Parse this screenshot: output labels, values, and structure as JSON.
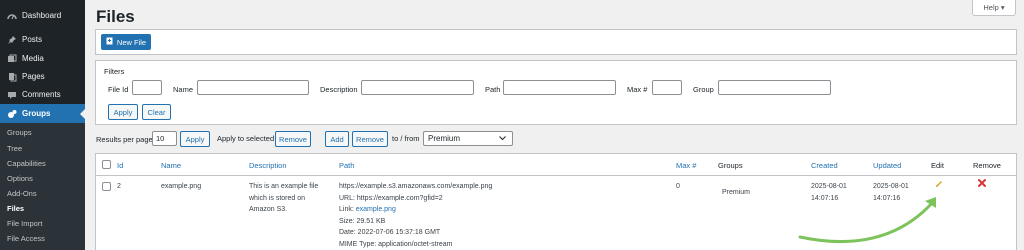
{
  "sidebar": {
    "items": [
      {
        "label": "Dashboard",
        "icon": "dashboard-icon"
      },
      {
        "label": "Posts",
        "icon": "pin-icon"
      },
      {
        "label": "Media",
        "icon": "media-icon"
      },
      {
        "label": "Pages",
        "icon": "pages-icon"
      },
      {
        "label": "Comments",
        "icon": "comments-icon"
      },
      {
        "label": "Groups",
        "icon": "groups-icon"
      }
    ],
    "submenu": [
      "Groups",
      "Tree",
      "Capabilities",
      "Options",
      "Add-Ons",
      "Files",
      "File Import",
      "File Access"
    ]
  },
  "header": {
    "title": "Files",
    "help_label": "Help ▾"
  },
  "toolbar": {
    "new_file_label": "New File"
  },
  "filters": {
    "title": "Filters",
    "file_id_label": "File Id",
    "name_label": "Name",
    "description_label": "Description",
    "path_label": "Path",
    "max_label": "Max #",
    "group_label": "Group",
    "apply_label": "Apply",
    "clear_label": "Clear"
  },
  "bulk": {
    "results_per_page_label": "Results per page",
    "results_per_page_value": "10",
    "apply_label": "Apply",
    "apply_to_selected_label": "Apply to selected",
    "remove_label": "Remove",
    "add_label": "Add",
    "remove2_label": "Remove",
    "to_from_label": "to / from",
    "group_select_value": "Premium"
  },
  "table": {
    "headers": {
      "id": "Id",
      "name": "Name",
      "description": "Description",
      "path": "Path",
      "max": "Max #",
      "groups": "Groups",
      "created": "Created",
      "updated": "Updated",
      "edit": "Edit",
      "remove": "Remove"
    },
    "row": {
      "id": "2",
      "name": "example.png",
      "description": [
        "This is an example file",
        "which is stored on",
        "Amazon S3."
      ],
      "path": "https://example.s3.amazonaws.com/example.png",
      "url": "URL: https://example.com?gfid=2",
      "link_label": "Link:",
      "link_text": "example.png",
      "size": "Size: 29.51 KB",
      "date": "Date: 2022-07-06 15:37:18 GMT",
      "mime": "MIME Type: application/octet-stream",
      "max": "0",
      "groups": "Premium",
      "created_date": "2025-08-01",
      "created_time": "14:07:16",
      "updated_date": "2025-08-01",
      "updated_time": "14:07:16"
    }
  },
  "colors": {
    "accent": "#2271b1",
    "sidebar": "#1d2327",
    "arrow": "#7dc35b",
    "remove": "#d63638",
    "edit": "#dba617"
  }
}
